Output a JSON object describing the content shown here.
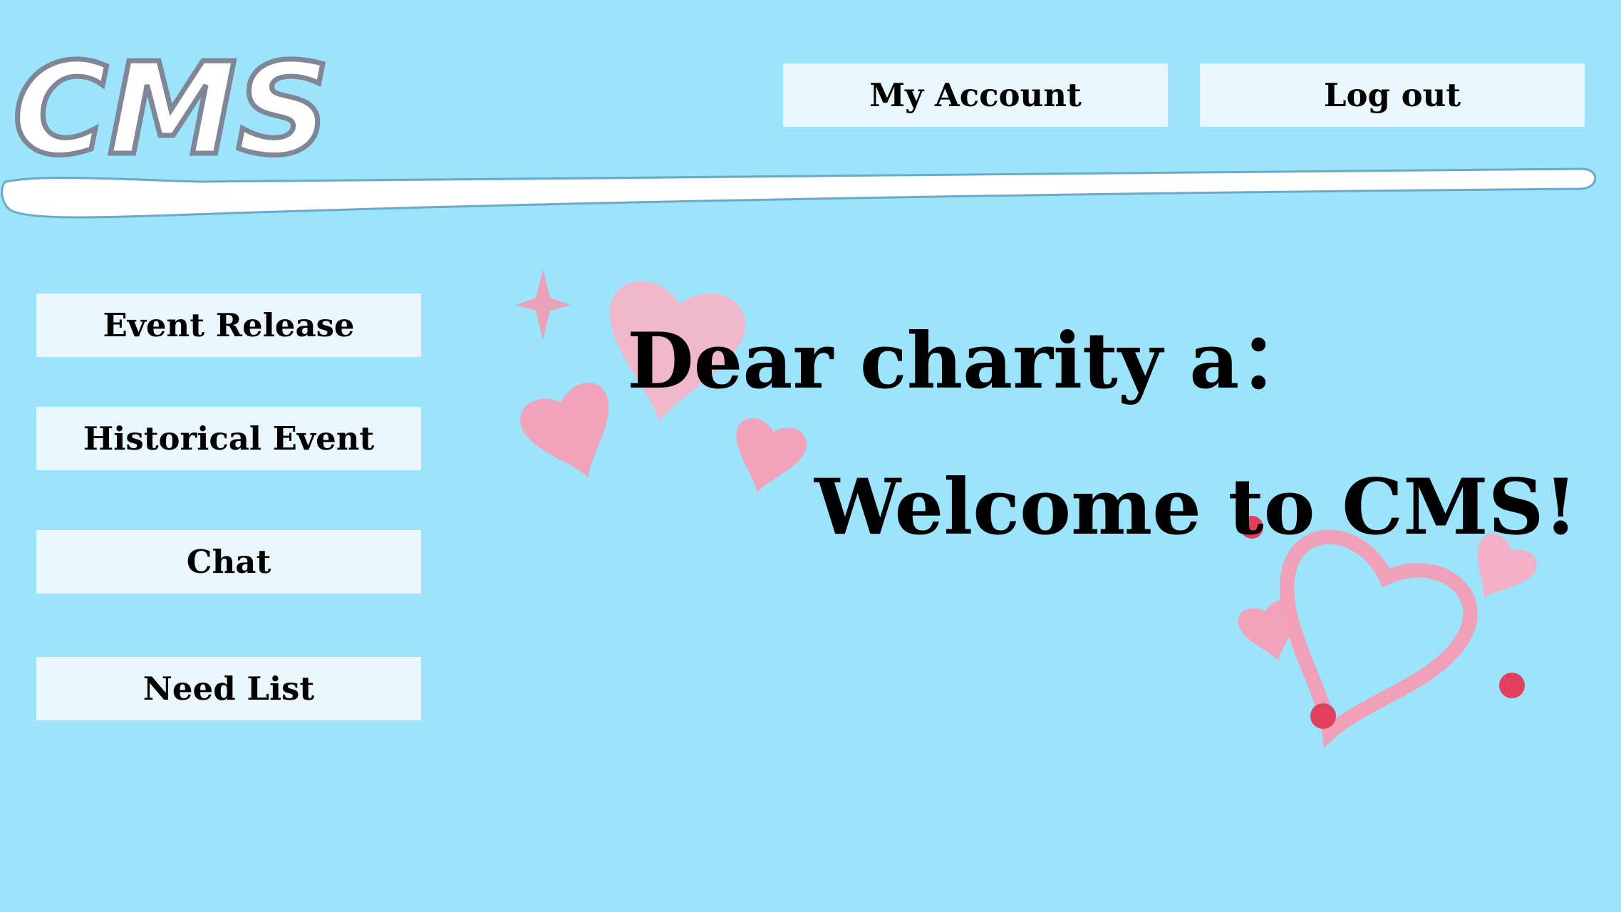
{
  "header": {
    "logo_text": "CMS",
    "my_account_label": "My Account",
    "logout_label": "Log out"
  },
  "sidebar": {
    "items": [
      {
        "label": "Event Release"
      },
      {
        "label": "Historical Event"
      },
      {
        "label": "Chat"
      },
      {
        "label": "Need List"
      }
    ]
  },
  "main": {
    "greeting": "Dear charity a：",
    "welcome": "Welcome to CMS!"
  },
  "colors": {
    "background": "#9be4fb",
    "button_bg": "#e9f7fd",
    "heart_pink": "#f4a6b9",
    "heart_red": "#e0405d"
  },
  "icons": {
    "logo": "cms-logo",
    "decoration": "heart-doodle-icon"
  }
}
